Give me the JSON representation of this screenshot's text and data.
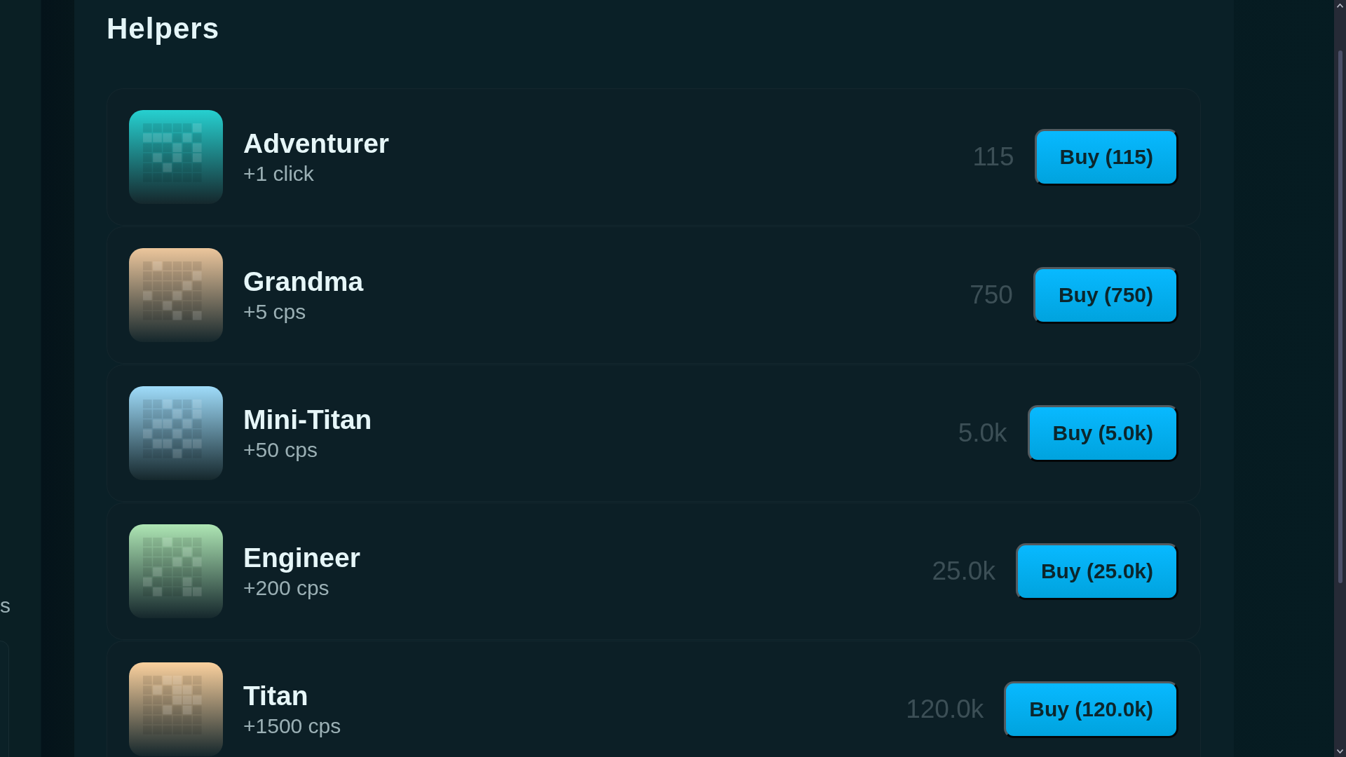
{
  "sidebar": {
    "text_fragment": "s"
  },
  "helpers_panel": {
    "title": "Helpers",
    "helpers": [
      {
        "name": "Adventurer",
        "effect": "+1 click",
        "price": "115",
        "buy_label": "Buy (115)",
        "color": "#26d0d0"
      },
      {
        "name": "Grandma",
        "effect": "+5 cps",
        "price": "750",
        "buy_label": "Buy (750)",
        "color": "#ecc69c"
      },
      {
        "name": "Mini-Titan",
        "effect": "+50 cps",
        "price": "5.0k",
        "buy_label": "Buy (5.0k)",
        "color": "#9fdcfa"
      },
      {
        "name": "Engineer",
        "effect": "+200 cps",
        "price": "25.0k",
        "buy_label": "Buy (25.0k)",
        "color": "#aee6b4"
      },
      {
        "name": "Titan",
        "effect": "+1500 cps",
        "price": "120.0k",
        "buy_label": "Buy (120.0k)",
        "color": "#fbd19e"
      }
    ]
  }
}
